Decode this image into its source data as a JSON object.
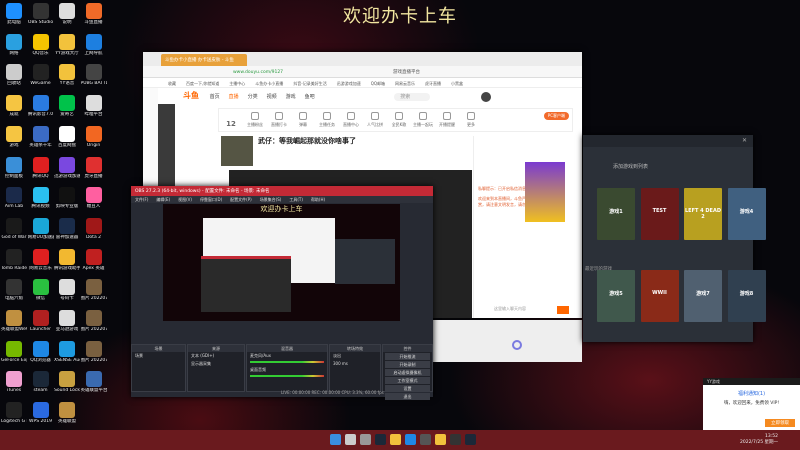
{
  "banner": "欢迎办卡上车",
  "desktop_icons": [
    [
      "此电脑",
      "#1e90ff"
    ],
    [
      "OBS Studio",
      "#333"
    ],
    [
      "说明",
      "#ddd"
    ],
    [
      "斗鱼直播",
      "#f06a28"
    ],
    [
      "网络",
      "#2aa0e0"
    ],
    [
      "QQ音乐",
      "#f5c400"
    ],
    [
      "YY游戏大厅",
      "#f2c23c"
    ],
    [
      "上网导航",
      "#1d7fe0"
    ],
    [
      "回收站",
      "#ccc"
    ],
    [
      "WeGame",
      "#222"
    ],
    [
      "YY语音",
      "#f2c23c"
    ],
    [
      "PUBG BATTLEGROUNDS",
      "#444"
    ],
    [
      "成就",
      "#f5c542"
    ],
    [
      "腾讯影音7.0",
      "#2a7be0"
    ],
    [
      "爱奇艺",
      "#00c24a"
    ],
    [
      "哔哩平台",
      "#ddd"
    ],
    [
      "游戏",
      "#f5c542"
    ],
    [
      "英雄杀千年",
      "#3b6bc4"
    ],
    [
      "百度网盘",
      "#fff"
    ],
    [
      "Origin",
      "#f26722"
    ],
    [
      "控制面板",
      "#3a8fd8"
    ],
    [
      "腾讯QQ",
      "#e02020"
    ],
    [
      "迅游游戏加速",
      "#7a48e0"
    ],
    [
      "虎牙直播",
      "#e03030"
    ],
    [
      "Aim Lab",
      "#1b2a4a"
    ],
    [
      "腾讯视频",
      "#2ac0f0"
    ],
    [
      "剪映专业版",
      "#111"
    ],
    [
      "糖豆人",
      "#ff5fa0"
    ],
    [
      "God of War",
      "#1a1a1a"
    ],
    [
      "网易UU加速器",
      "#1aa8d8"
    ],
    [
      "雷神加速器",
      "#1a2c4a"
    ],
    [
      "Dota 2",
      "#a01818"
    ],
    [
      "Tomb Raider",
      "#222"
    ],
    [
      "网易云音乐",
      "#e02020"
    ],
    [
      "腾讯游戏助手",
      "#f2b830"
    ],
    [
      "Apex 英雄",
      "#c02020"
    ],
    [
      "电脑六角",
      "#333"
    ],
    [
      "微信",
      "#2ac040"
    ],
    [
      "号码卡",
      "#ddd"
    ],
    [
      "图片 20220716",
      "#7a6040"
    ],
    [
      "英雄联盟WeGame版",
      "#c09040"
    ],
    [
      "Launcher",
      "#b02020"
    ],
    [
      "亚马逊游戏",
      "#ddd"
    ],
    [
      "图片 20220716",
      "#7a6040"
    ],
    [
      "GeForce Experience",
      "#76b900"
    ],
    [
      "QQ浏览器",
      "#1e88e5"
    ],
    [
      "XSENSE Audio",
      "#1e9be0"
    ],
    [
      "图片 20220717",
      "#7a6040"
    ],
    [
      "iTunes",
      "#f0a0d0"
    ],
    [
      "steam",
      "#1b2838"
    ],
    [
      "Sound Lock",
      "#c8a040"
    ],
    [
      "英雄联盟平台",
      "#3a6ab0"
    ],
    [
      "Logitech G HUB",
      "#222"
    ],
    [
      "WPS 2019",
      "#2a6ae0"
    ],
    [
      "英雄联盟",
      "#c09040"
    ]
  ],
  "browser": {
    "tab": "斗鱼办卡小直播 办卡送皮肤 - 斗鱼",
    "url": "www.douyu.com/9127",
    "search": "游戏直播平台",
    "bookmarks": [
      "收藏",
      "百度一下,你就知道",
      "主播中心",
      "斗鱼办卡小直播",
      "抖音-记录美好生活",
      "迅游游戏加速",
      "QQ邮箱",
      "网易云音乐",
      "虎牙直播",
      "小黑盒"
    ],
    "nav": [
      "首页",
      "直播",
      "分类",
      "视频",
      "游戏",
      "鱼吧"
    ],
    "logo": "斗鱼",
    "search_placeholder": "搜索",
    "tools": [
      "主播粉丝",
      "直播打卡",
      "弹幕",
      "主播任务",
      "直播中心",
      "人气比拼",
      "全民K歌",
      "主播一起玩",
      "开播提醒",
      "更多"
    ],
    "fans": "12",
    "pc_client": "PC客户端",
    "streamer_title": "武仔：等我崛起那就没你啥事了",
    "follow": "关注",
    "chat_lines": [
      "私聊提示：已开启私信消息",
      "欢迎来到本直播间，斗鱼严禁未成年人直播或打赏，请注意文明发言，请勿发布违规内容。"
    ],
    "chat_placeholder": "这里输入聊天内容"
  },
  "obs": {
    "title": "OBS 27.2.3 (64-bit, windows) - 配置文件: 未命名 - 场景: 未命名",
    "menu": [
      "文件(F)",
      "编辑(E)",
      "视图(V)",
      "停靠窗口(D)",
      "配置文件(P)",
      "场景集合(S)",
      "工具(T)",
      "帮助(H)"
    ],
    "preview_banner": "欢迎办卡上车",
    "panels": [
      "场景",
      "来源",
      "混音器",
      "转场特效",
      "控件"
    ],
    "scene": "场景",
    "sources": [
      "文本 (GDI+)",
      "显示器采集"
    ],
    "mixer": [
      "麦克风/Aux",
      "桌面音频"
    ],
    "transition": "淡出",
    "duration_label": "时长",
    "duration": "300 ms",
    "controls": [
      "开始推流",
      "开始录制",
      "启动虚拟摄像机",
      "工作室模式",
      "设置",
      "退出"
    ],
    "status": "LIVE: 00:00:00   REC: 00:00:00   CPU: 3.3%, 60.00 fps"
  },
  "launcher": {
    "add_label": "添加游戏到列表",
    "section2": "最近玩的游戏",
    "covers": [
      [
        "#3a4a30",
        "游戏1"
      ],
      [
        "#6a1a1a",
        "TEST"
      ],
      [
        "#b8a020",
        "LEFT 4 DEAD 2"
      ],
      [
        "#406080",
        "游戏4"
      ],
      [
        "#40584c",
        "游戏5"
      ],
      [
        "#8a2a18",
        "WWII"
      ],
      [
        "#506070",
        "游戏7"
      ],
      [
        "#304050",
        "游戏8"
      ]
    ]
  },
  "popup": {
    "header": "YY游戏",
    "title": "福利通知(1)",
    "body": "嗨，欢迎回来，免费领 VIP!",
    "button": "立即领取"
  },
  "taskbar": {
    "time": "13:52",
    "date": "2022/7/25 星期一"
  }
}
